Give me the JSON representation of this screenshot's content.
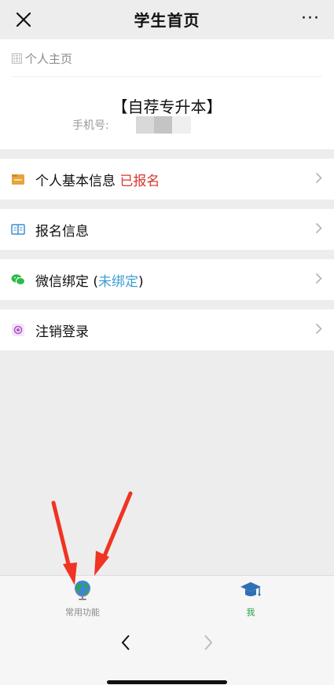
{
  "header": {
    "title": "学生首页",
    "more_label": "···"
  },
  "profile": {
    "breadcrumb": "个人主页",
    "name": "【自荐专升本】",
    "phone_label": "手机号:"
  },
  "menu": [
    {
      "label": "个人基本信息",
      "status": "已报名",
      "icon": "folder-icon",
      "status_color": "#d9342b"
    },
    {
      "label": "报名信息",
      "icon": "book-icon"
    },
    {
      "label": "微信绑定 (",
      "status": "未绑定",
      "suffix": ")",
      "icon": "wechat-icon",
      "status_color": "#3b9fd3"
    },
    {
      "label": "注销登录",
      "icon": "logout-icon"
    }
  ],
  "tabbar": {
    "common_label": "常用功能",
    "me_label": "我",
    "active_color": "#26a041"
  },
  "colors": {
    "background": "#ededed",
    "annotation_arrow": "#f03322"
  }
}
